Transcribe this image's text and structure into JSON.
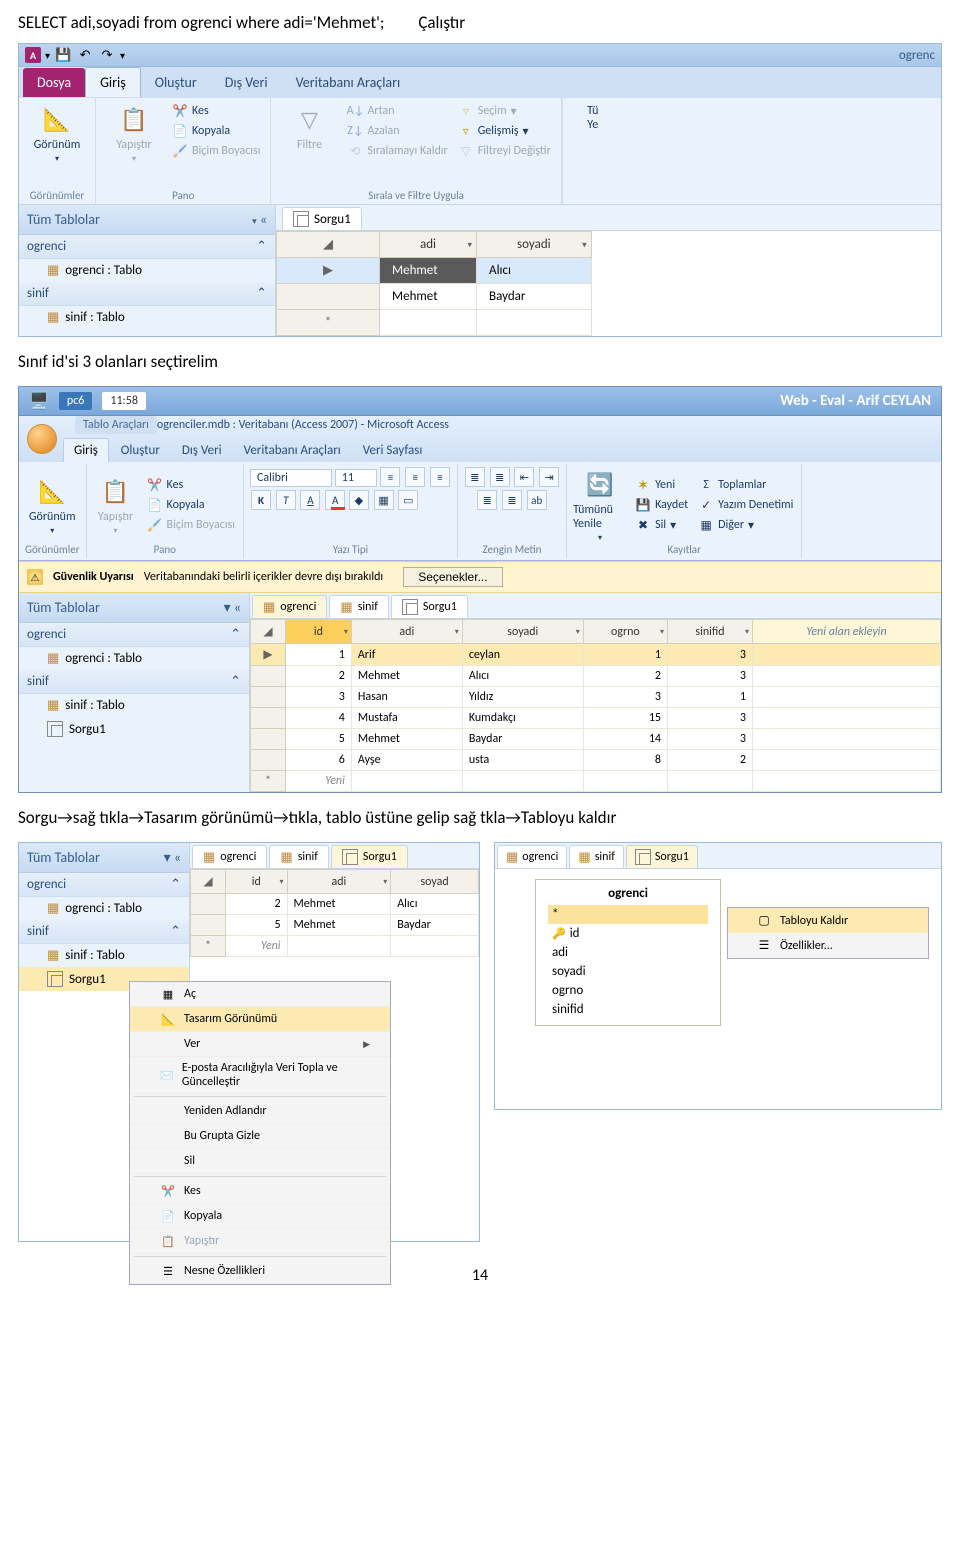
{
  "sql_line": {
    "code": "SELECT adi,soyadi from ogrenci where adi='Mehmet';",
    "run_label": "Çalıştır"
  },
  "section2_text": "Sınıf id'si 3 olanları seçtirelim",
  "section3_text": "Sorgu→sağ tıkla→Tasarım görünümü→tıkla, tablo üstüne gelip sağ tkla→Tabloyu kaldır",
  "page_number": "14",
  "s1": {
    "title_right": "ogrenc",
    "file_tab": "Dosya",
    "tabs": [
      "Giriş",
      "Oluştur",
      "Dış Veri",
      "Veritabanı Araçları"
    ],
    "ribbon": {
      "gorunum": "Görünüm",
      "gorunumler": "Görünümler",
      "yapistir": "Yapıştır",
      "kes": "Kes",
      "kopyala": "Kopyala",
      "bicim": "Biçim Boyacısı",
      "pano": "Pano",
      "filtre": "Filtre",
      "artan": "Artan",
      "azalan": "Azalan",
      "siralamayi_kaldir": "Sıralamayı Kaldır",
      "secim": "Seçim",
      "gelismis": "Gelişmiş",
      "filtreyi_degistir": "Filtreyi Değiştir",
      "sirala_filtre": "Sırala ve Filtre Uygula",
      "tu": "Tü",
      "ye": "Ye"
    },
    "nav": {
      "header": "Tüm Tablolar",
      "g_ogrenci": "ogrenci",
      "i_ogrenci": "ogrenci : Tablo",
      "g_sinif": "sinif",
      "i_sinif": "sinif : Tablo"
    },
    "docTab": "Sorgu1",
    "grid": {
      "cols": [
        "adi",
        "soyadi"
      ],
      "rows": [
        {
          "adi": "Mehmet",
          "soyadi": "Alıcı"
        },
        {
          "adi": "Mehmet",
          "soyadi": "Baydar"
        }
      ],
      "newrow_marker": "*"
    }
  },
  "s2": {
    "titlebar": {
      "pc": "pc6",
      "time": "11:58",
      "title_right": "Web - Eval - Arif CEYLAN"
    },
    "context_label": "Tablo Araçları",
    "db_path": "ogrenciler.mdb : Veritabanı (Access 2007) - Microsoft Access",
    "tabs": [
      "Giriş",
      "Oluştur",
      "Dış Veri",
      "Veritabanı Araçları",
      "Veri Sayfası"
    ],
    "ribbon": {
      "gorunum": "Görünüm",
      "gorunumler": "Görünümler",
      "yapistir": "Yapıştır",
      "kes": "Kes",
      "kopyala": "Kopyala",
      "bicim": "Biçim Boyacısı",
      "pano": "Pano",
      "font_name": "Calibri",
      "font_size": "11",
      "yazitipi": "Yazı Tipi",
      "zenginmetin": "Zengin Metin",
      "tumunu_yenile": "Tümünü Yenile",
      "yeni": "Yeni",
      "kaydet": "Kaydet",
      "sil": "Sil",
      "toplamlar": "Toplamlar",
      "yazim": "Yazım Denetimi",
      "diger": "Diğer",
      "kayitlar": "Kayıtlar"
    },
    "warn": {
      "bold": "Güvenlik Uyarısı",
      "text": "Veritabanındaki belirli içerikler devre dışı bırakıldı",
      "opt": "Seçenekler..."
    },
    "nav": {
      "header": "Tüm Tablolar",
      "g_ogrenci": "ogrenci",
      "i_ogrenci": "ogrenci : Tablo",
      "g_sinif": "sinif",
      "i_sinif": "sinif : Tablo",
      "i_sorgu": "Sorgu1"
    },
    "docTabs": [
      "ogrenci",
      "sinif",
      "Sorgu1"
    ],
    "grid": {
      "cols": [
        "id",
        "adi",
        "soyadi",
        "ogrno",
        "sinifid"
      ],
      "addCol": "Yeni alan ekleyin",
      "rows": [
        {
          "id": "1",
          "adi": "Arif",
          "soyadi": "ceylan",
          "ogrno": "1",
          "sinifid": "3"
        },
        {
          "id": "2",
          "adi": "Mehmet",
          "soyadi": "Alıcı",
          "ogrno": "2",
          "sinifid": "3"
        },
        {
          "id": "3",
          "adi": "Hasan",
          "soyadi": "Yıldız",
          "ogrno": "3",
          "sinifid": "1"
        },
        {
          "id": "4",
          "adi": "Mustafa",
          "soyadi": "Kumdakçı",
          "ogrno": "15",
          "sinifid": "3"
        },
        {
          "id": "5",
          "adi": "Mehmet",
          "soyadi": "Baydar",
          "ogrno": "14",
          "sinifid": "3"
        },
        {
          "id": "6",
          "adi": "Ayşe",
          "soyadi": "usta",
          "ogrno": "8",
          "sinifid": "2"
        }
      ],
      "yeni": "Yeni",
      "newrow_marker": "*"
    }
  },
  "s3a": {
    "nav": {
      "header": "Tüm Tablolar",
      "g_ogrenci": "ogrenci",
      "i_ogrenci": "ogrenci : Tablo",
      "g_sinif": "sinif",
      "i_sinif": "sinif : Tablo",
      "i_sorgu": "Sorgu1"
    },
    "docTabs": [
      "ogrenci",
      "sinif",
      "Sorgu1"
    ],
    "grid": {
      "cols": [
        "id",
        "adi",
        "soyad"
      ],
      "rows": [
        {
          "id": "2",
          "adi": "Mehmet",
          "soyad": "Alıcı"
        },
        {
          "id": "5",
          "adi": "Mehmet",
          "soyad": "Baydar"
        }
      ],
      "yeni": "Yeni",
      "newrow_marker": "*"
    },
    "ctx": {
      "ac": "Aç",
      "tasarim": "Tasarım Görünümü",
      "ver": "Ver",
      "eposta": "E-posta Aracılığıyla Veri Topla ve Güncelleştir",
      "yeniden": "Yeniden Adlandır",
      "gizle": "Bu Grupta Gizle",
      "sil": "Sil",
      "kes": "Kes",
      "kopyala": "Kopyala",
      "yapistir": "Yapıştır",
      "nesne": "Nesne Özellikleri"
    }
  },
  "s3b": {
    "docTabs": [
      "ogrenci",
      "sinif",
      "Sorgu1"
    ],
    "fieldlist": {
      "title": "ogrenci",
      "star": "*",
      "items": [
        "id",
        "adi",
        "soyadi",
        "ogrno",
        "sinifid"
      ]
    },
    "ctx": {
      "kaldir": "Tabloyu Kaldır",
      "ozellikler": "Özellikler..."
    }
  }
}
